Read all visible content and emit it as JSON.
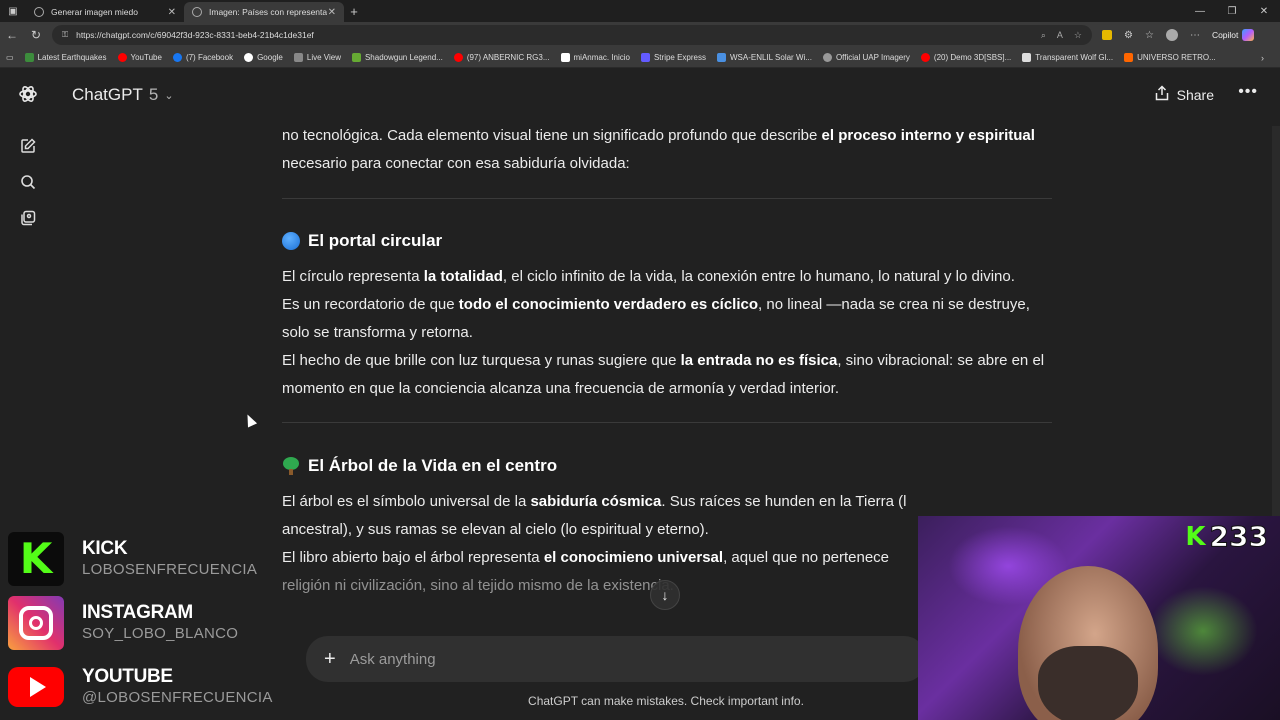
{
  "browser": {
    "tabs": [
      {
        "title": "Generar imagen miedo"
      },
      {
        "title": "Imagen: Países con representació"
      }
    ],
    "url": "https://chatgpt.com/c/69042f3d-923c-8331-beb4-21b4c1de31ef",
    "copilot_label": "Copilot",
    "bookmarks": [
      {
        "label": "Latest Earthquakes",
        "color": "#3c8c3c"
      },
      {
        "label": "YouTube",
        "color": "#ff0000"
      },
      {
        "label": "(7) Facebook",
        "color": "#1877f2"
      },
      {
        "label": "Google",
        "color": "#ffffff"
      },
      {
        "label": "Live View",
        "color": "#888888"
      },
      {
        "label": "Shadowgun Legend...",
        "color": "#66aa33"
      },
      {
        "label": "(97) ANBERNIC RG3...",
        "color": "#ff0000"
      },
      {
        "label": "miAnmac. Inicio",
        "color": "#ffffff"
      },
      {
        "label": "Stripe Express",
        "color": "#635bff"
      },
      {
        "label": "WSA-ENLIL Solar Wi...",
        "color": "#4a90e2"
      },
      {
        "label": "Official UAP Imagery",
        "color": "#999999"
      },
      {
        "label": "(20) Demo 3D[SBS]...",
        "color": "#ff0000"
      },
      {
        "label": "Transparent Wolf Gl...",
        "color": "#dddddd"
      },
      {
        "label": "UNIVERSO RETRO...",
        "color": "#ff6600"
      }
    ]
  },
  "app": {
    "model_name": "ChatGPT",
    "model_version": "5",
    "share_label": "Share",
    "composer_placeholder": "Ask anything",
    "disclaimer": "ChatGPT can make mistakes. Check important info."
  },
  "content": {
    "intro": {
      "t1": "no tecnológica. Cada elemento visual tiene un significado profundo que describe ",
      "b1": "el proceso interno y espiritual",
      "t2": " necesario para conectar con esa sabiduría olvidada:"
    },
    "section1": {
      "heading": "El portal circular",
      "p1_t1": "El círculo representa ",
      "p1_b1": "la totalidad",
      "p1_t2": ", el ciclo infinito de la vida, la conexión entre lo humano, lo natural y lo divino.",
      "p2_t1": "Es un recordatorio de que ",
      "p2_b1": "todo el conocimiento verdadero es cíclico",
      "p2_t2": ", no lineal —nada se crea ni se destruye, solo se transforma y retorna.",
      "p3_t1": "El hecho de que brille con luz turquesa y runas sugiere que ",
      "p3_b1": "la entrada no es física",
      "p3_t2": ", sino vibracional: se abre en el momento en que la conciencia alcanza una frecuencia de armonía y verdad interior."
    },
    "section2": {
      "heading": "El Árbol de la Vida en el centro",
      "p1_t1": "El árbol es el símbolo universal de la ",
      "p1_b1": "sabiduría cósmica",
      "p1_t2": ". Sus raíces se hunden en la Tierra (l",
      "p1_t3": "ancestral), y sus ramas se elevan al cielo (lo espiritual y eterno).",
      "p2_t1": "El libro abierto bajo el árbol representa ",
      "p2_b1": "el conocimien",
      "p2_b2": "o universal",
      "p2_t2": ", aquel que no pertenece",
      "p3_t1": "religión ni civilización, sino al tejido mismo de la existencia."
    }
  },
  "overlay": {
    "kick": {
      "name": "KICK",
      "handle": "LOBOSENFRECUENCIA"
    },
    "instagram": {
      "name": "INSTAGRAM",
      "handle": "SOY_LOBO_BLANCO"
    },
    "youtube": {
      "name": "YOUTUBE",
      "handle": "@LOBOSENFRECUENCIA"
    },
    "viewer_count": "233"
  }
}
